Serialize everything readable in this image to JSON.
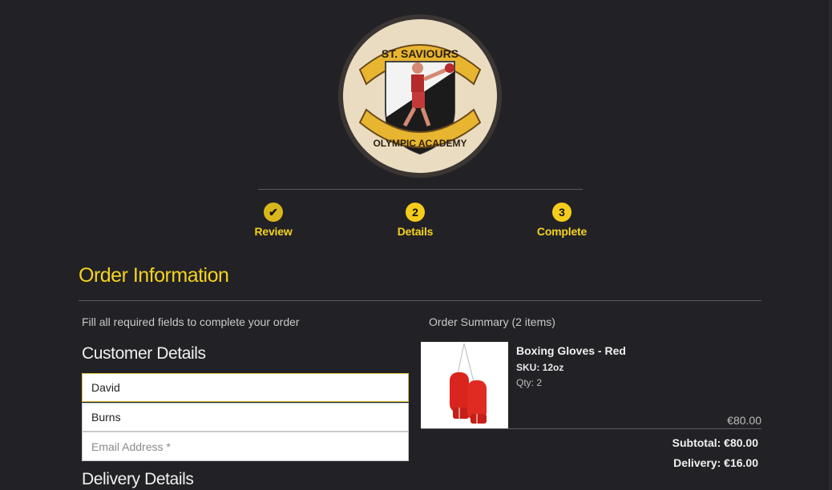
{
  "logo": {
    "top_text": "ST. SAVIOURS",
    "bottom_text": "OLYMPIC ACADEMY"
  },
  "steps": [
    {
      "label": "Review",
      "marker": "✔"
    },
    {
      "label": "Details",
      "marker": "2"
    },
    {
      "label": "Complete",
      "marker": "3"
    }
  ],
  "page": {
    "title": "Order Information",
    "instructions": "Fill all required fields to complete your order"
  },
  "customer": {
    "heading": "Customer Details",
    "first_name_value": "David",
    "last_name_value": "Burns",
    "email_placeholder": "Email Address *"
  },
  "delivery": {
    "heading": "Delivery Details"
  },
  "summary": {
    "heading": "Order Summary (2 items)",
    "item": {
      "name": "Boxing Gloves - Red",
      "sku": "SKU: 12oz",
      "qty": "Qty: 2",
      "price": "€80.00"
    },
    "subtotal": "Subtotal: €80.00",
    "delivery": "Delivery: €16.00"
  },
  "colors": {
    "background": "#222226",
    "accent": "#f5d21e"
  }
}
